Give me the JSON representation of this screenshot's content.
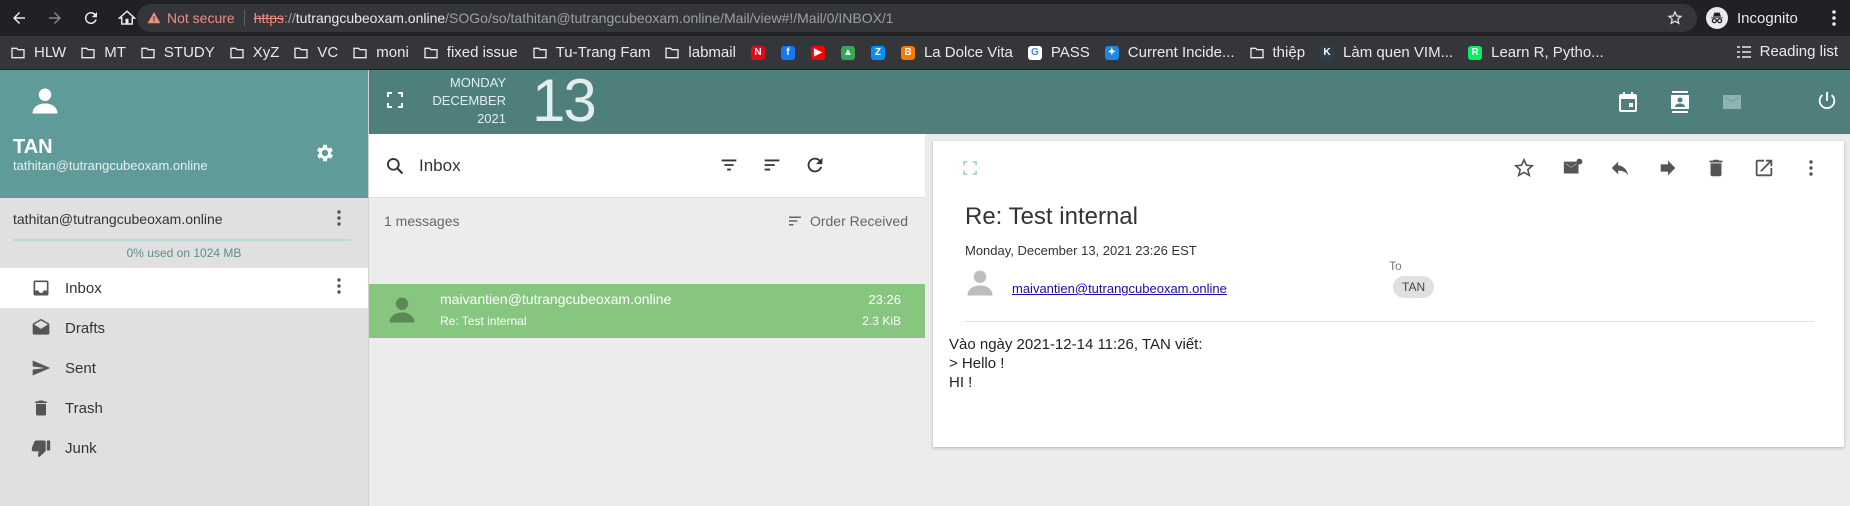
{
  "browser": {
    "url_warning": "Not secure",
    "url_protocol": "https",
    "url_host": "tutrangcubeoxam.online",
    "url_path": "/SOGo/so/tathitan@tutrangcubeoxam.online/Mail/view#!/Mail/0/INBOX/1",
    "incognito_label": "Incognito",
    "reading_list": "Reading list",
    "bookmarks": [
      {
        "label": "HLW",
        "icon": "folder-icon"
      },
      {
        "label": "MT",
        "icon": "folder-icon"
      },
      {
        "label": "STUDY",
        "icon": "folder-icon"
      },
      {
        "label": "XyZ",
        "icon": "folder-icon"
      },
      {
        "label": "VC",
        "icon": "folder-icon"
      },
      {
        "label": "moni",
        "icon": "folder-icon"
      },
      {
        "label": "fixed issue",
        "icon": "folder-icon"
      },
      {
        "label": "Tu-Trang Fam",
        "icon": "folder-icon"
      },
      {
        "label": "labmail",
        "icon": "folder-icon"
      },
      {
        "label": "",
        "icon": "netflix-icon",
        "color": "#e50914",
        "glyph": "N"
      },
      {
        "label": "",
        "icon": "facebook-icon",
        "color": "#1877f2",
        "glyph": "f"
      },
      {
        "label": "",
        "icon": "youtube-icon",
        "color": "#ff0000",
        "glyph": "▶"
      },
      {
        "label": "",
        "icon": "google-drive-icon",
        "color": "#34a853",
        "glyph": "▲"
      },
      {
        "label": "",
        "icon": "zalo-icon",
        "color": "#0091ff",
        "glyph": "Z"
      },
      {
        "label": "La Dolce Vita",
        "icon": "blogger-icon",
        "color": "#f57c00",
        "glyph": "B"
      },
      {
        "label": "PASS",
        "icon": "google-icon",
        "color": "#ffffff",
        "glyph": "G"
      },
      {
        "label": "Current Incide...",
        "icon": "incident-icon",
        "color": "#1e88e5",
        "glyph": "✦"
      },
      {
        "label": "thiệp",
        "icon": "folder-icon"
      },
      {
        "label": "Làm quen VIM...",
        "icon": "kipalog-icon",
        "color": "#2c3e50",
        "glyph": "K"
      },
      {
        "label": "Learn R, Pytho...",
        "icon": "datacamp-icon",
        "color": "#03ef62",
        "glyph": "R"
      }
    ]
  },
  "user": {
    "name": "TAN",
    "email": "tathitan@tutrangcubeoxam.online"
  },
  "account": {
    "email": "tathitan@tutrangcubeoxam.online",
    "quota": "0% used on 1024 MB",
    "quota_fraction": 0
  },
  "folders": [
    {
      "label": "Inbox",
      "icon": "inbox-icon",
      "active": true
    },
    {
      "label": "Drafts",
      "icon": "drafts-icon"
    },
    {
      "label": "Sent",
      "icon": "send-icon"
    },
    {
      "label": "Trash",
      "icon": "trash-icon"
    },
    {
      "label": "Junk",
      "icon": "thumb-down-icon"
    }
  ],
  "topbar": {
    "weekday": "MONDAY",
    "month": "DECEMBER",
    "year": "2021",
    "day": "13"
  },
  "list": {
    "search_label": "Inbox",
    "count": "1 messages",
    "sort": "Order Received",
    "messages": [
      {
        "from": "maivantien@tutrangcubeoxam.online",
        "subject": "Re: Test internal",
        "time": "23:26",
        "size": "2.3 KiB"
      }
    ]
  },
  "reader": {
    "subject": "Re: Test internal",
    "date": "Monday, December 13, 2021 23:26 EST",
    "to_label": "To",
    "from": "maivantien@tutrangcubeoxam.online",
    "to": "TAN",
    "body": [
      "Vào ngày 2021-12-14 11:26, TAN viết:",
      "> Hello !",
      "HI !"
    ]
  },
  "colors": {
    "accent": "#5f9c99",
    "topbar": "#4f7f7d",
    "selected_message": "#87c67f"
  }
}
